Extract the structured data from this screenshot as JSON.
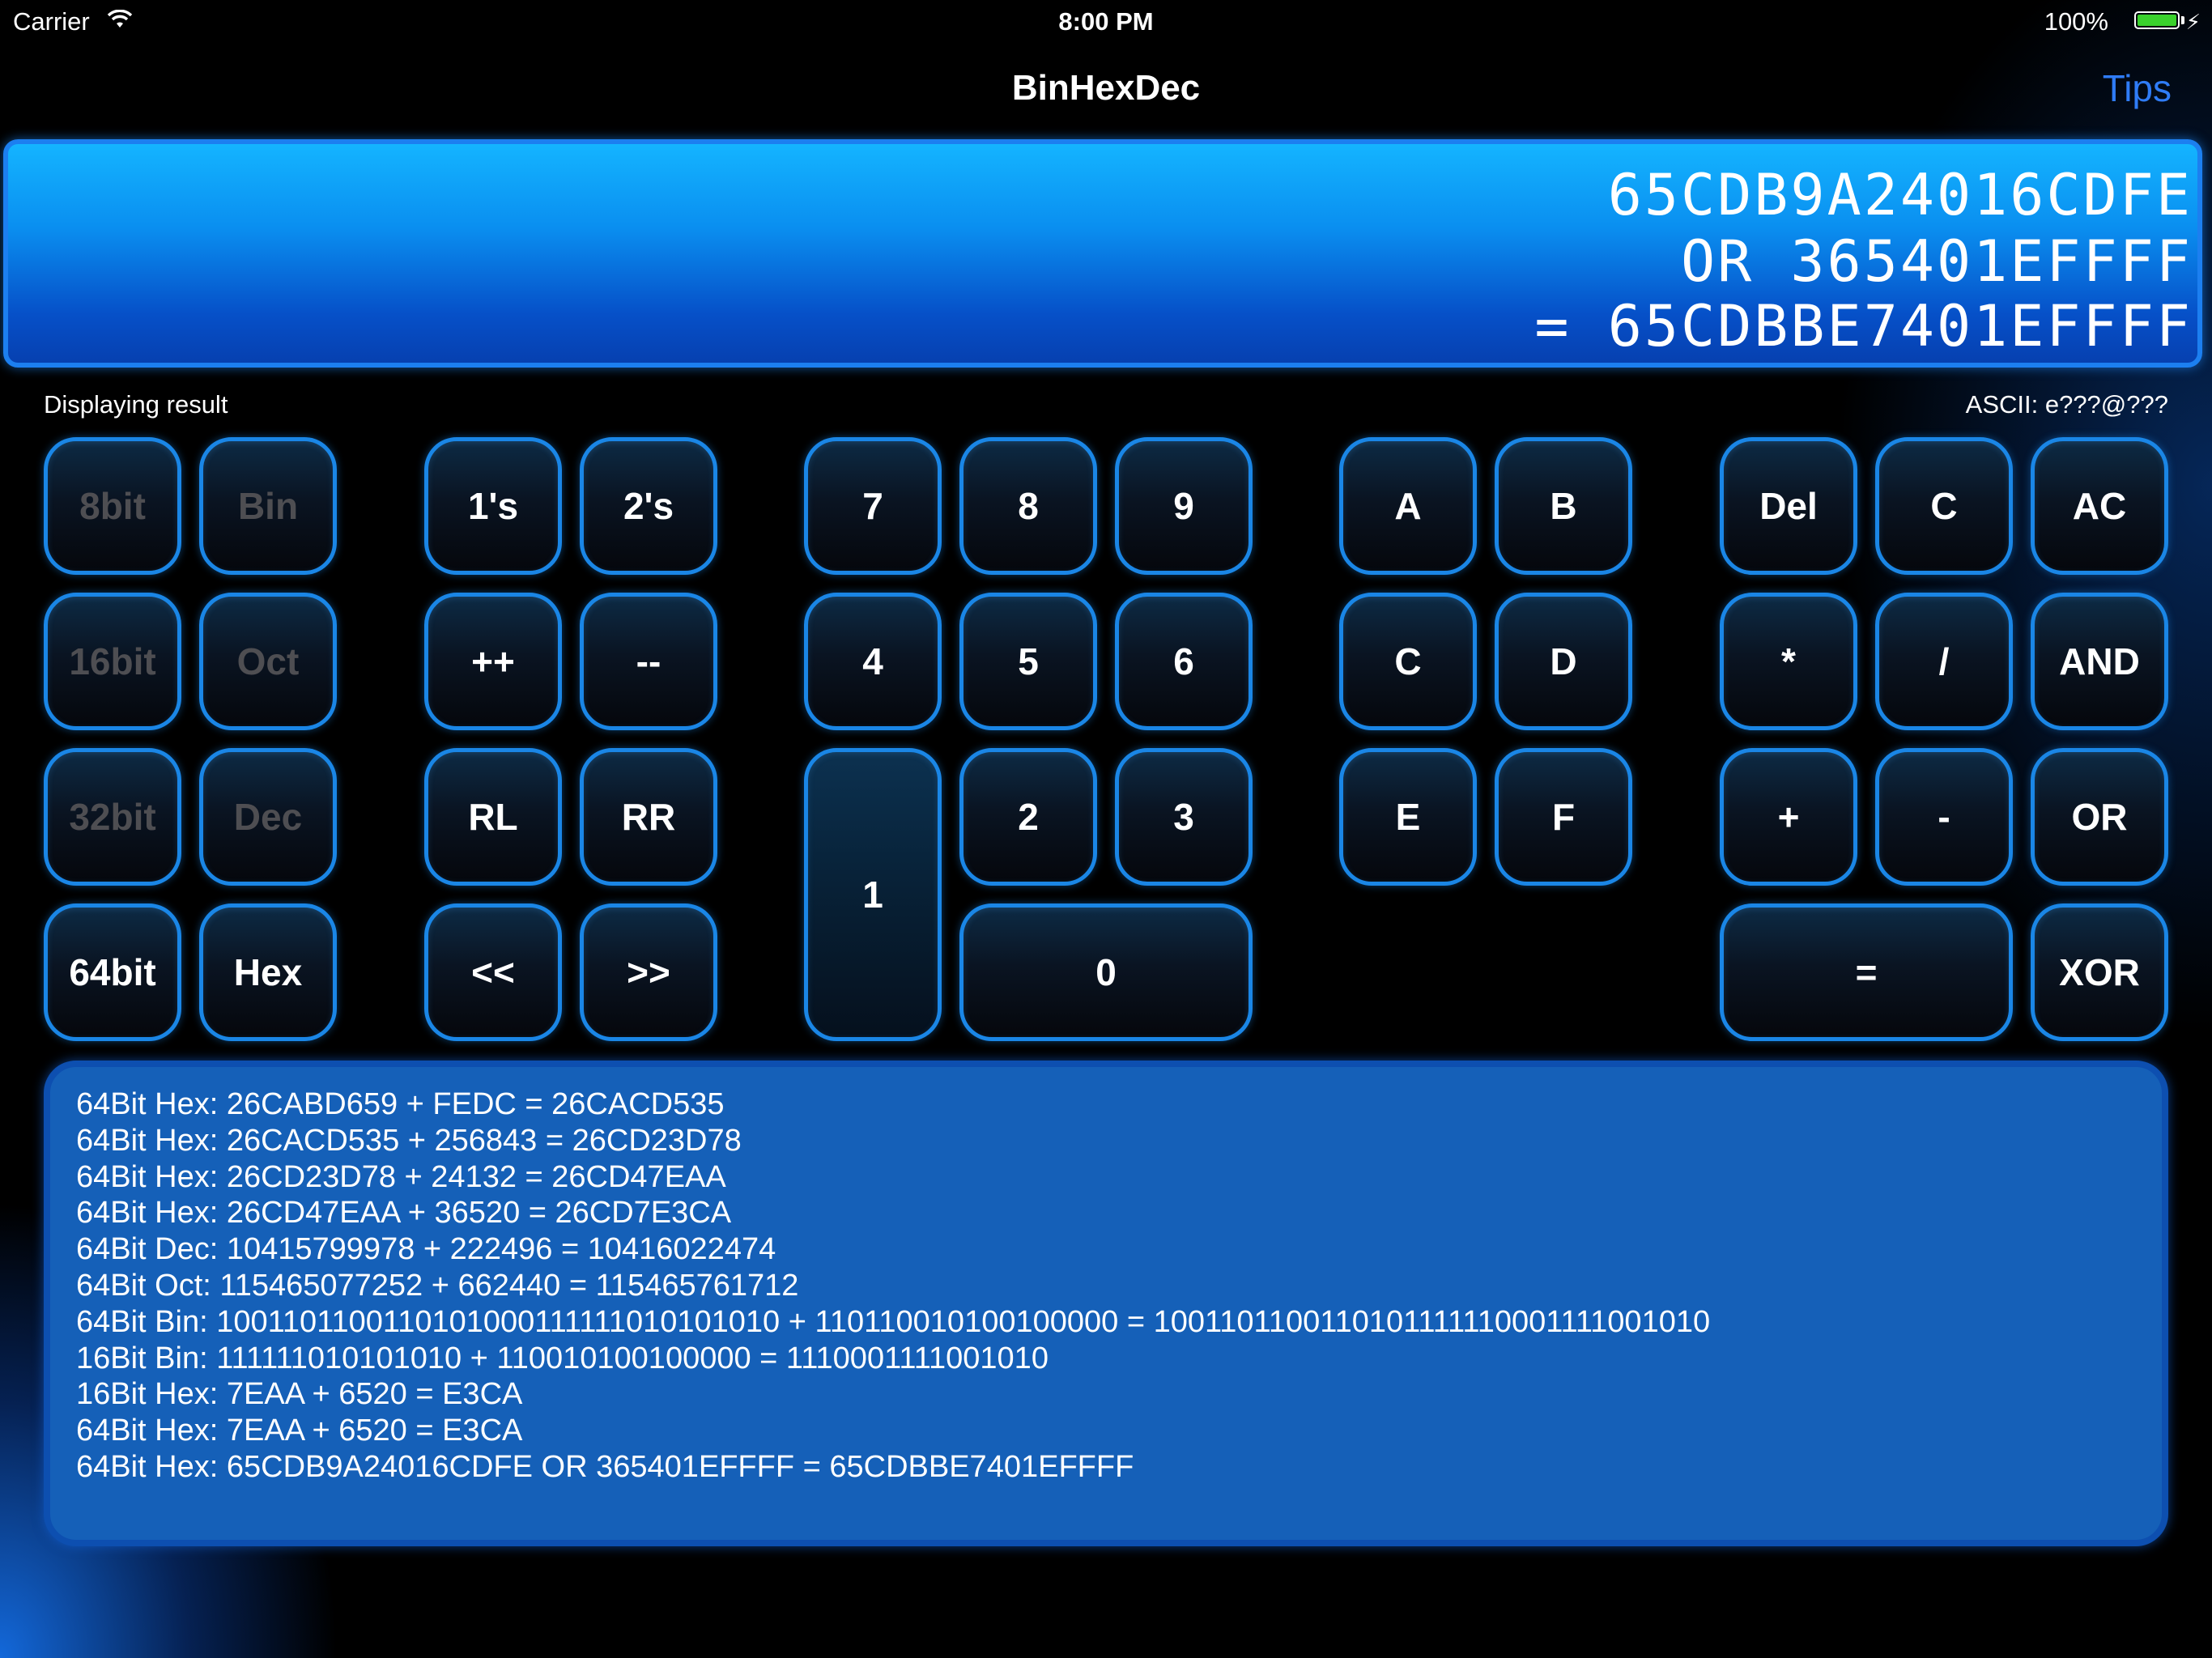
{
  "status_bar": {
    "carrier": "Carrier",
    "time": "8:00 PM",
    "battery": "100%",
    "battery_color": "#3ad12c"
  },
  "nav": {
    "title": "BinHexDec",
    "tips": "Tips",
    "tips_color": "#2f7cf6"
  },
  "display": {
    "line1": "65CDB9A24016CDFE",
    "line2": "OR 365401EFFFF",
    "line3": "= 65CDBBE7401EFFFF"
  },
  "info": {
    "status": "Displaying result",
    "ascii": "ASCII: e???@???"
  },
  "keys": {
    "k8bit": "8bit",
    "bin": "Bin",
    "ones": "1's",
    "twos": "2's",
    "d7": "7",
    "d8": "8",
    "d9": "9",
    "hA": "A",
    "hB": "B",
    "del": "Del",
    "clear": "C",
    "allclear": "AC",
    "k16bit": "16bit",
    "oct": "Oct",
    "inc": "++",
    "dec_op": "--",
    "d4": "4",
    "d5": "5",
    "d6": "6",
    "hC": "C",
    "hD": "D",
    "mul": "*",
    "div": "/",
    "and": "AND",
    "k32bit": "32bit",
    "dec": "Dec",
    "rl": "RL",
    "rr": "RR",
    "d2": "2",
    "d3": "3",
    "hE": "E",
    "hF": "F",
    "plus": "+",
    "minus": "-",
    "or": "OR",
    "k64bit": "64bit",
    "hex": "Hex",
    "shl": "<<",
    "shr": ">>",
    "d1": "1",
    "d0": "0",
    "equals": "=",
    "xor": "XOR"
  },
  "history": [
    "64Bit Hex: 26CABD659 + FEDC = 26CACD535",
    "64Bit Hex: 26CACD535 + 256843 = 26CD23D78",
    "64Bit Hex: 26CD23D78 + 24132 = 26CD47EAA",
    "64Bit Hex: 26CD47EAA + 36520 = 26CD7E3CA",
    "64Bit Dec: 10415799978 + 222496 = 10416022474",
    "64Bit Oct: 115465077252 + 662440 = 115465761712",
    "64Bit Bin: 1001101100110101000111111010101010 + 110110010100100000 = 1001101100110101111110001111001010",
    "16Bit Bin: 111111010101010 + 110010100100000 = 1110001111001010",
    "16Bit Hex: 7EAA + 6520 = E3CA",
    "64Bit Hex: 7EAA + 6520 = E3CA",
    "64Bit Hex: 65CDB9A24016CDFE OR 365401EFFFF = 65CDBBE7401EFFFF"
  ]
}
